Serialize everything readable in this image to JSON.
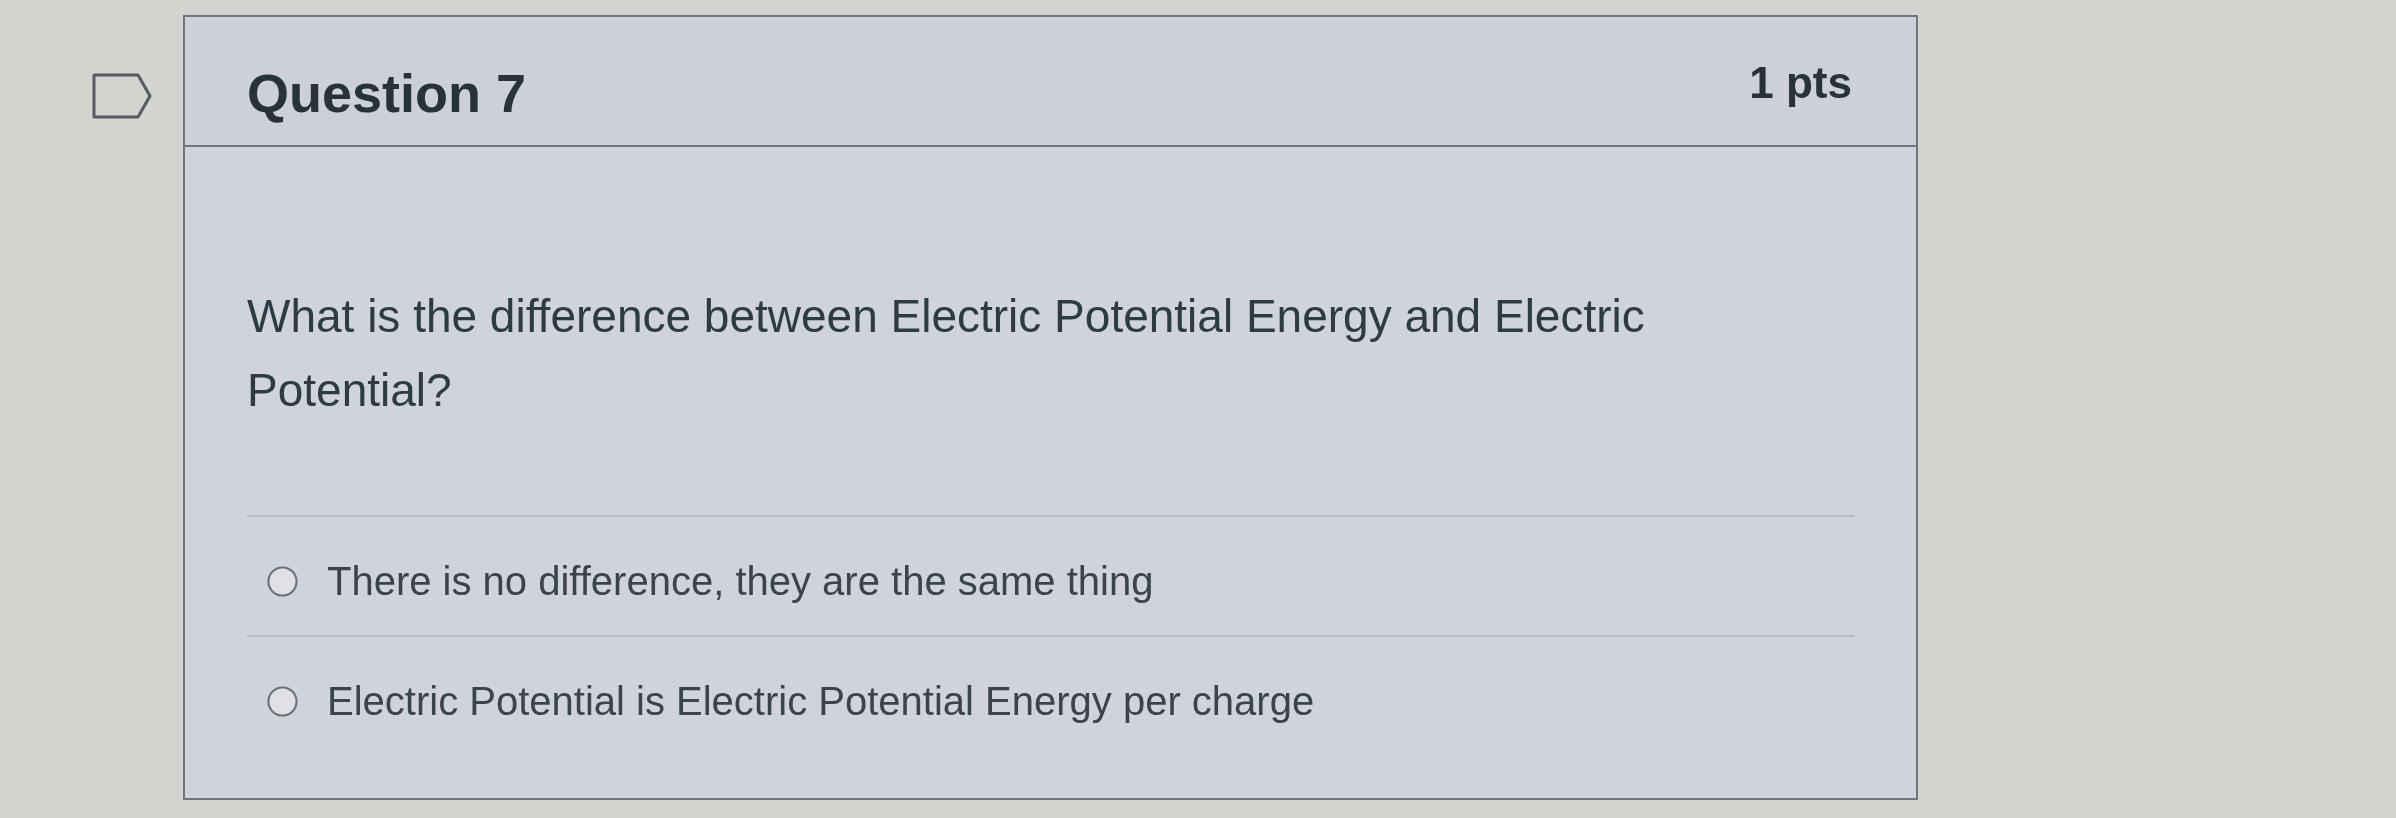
{
  "question": {
    "title": "Question 7",
    "points": "1 pts",
    "text": "What is the difference between Electric Potential Energy and Electric Potential?",
    "answers": [
      {
        "label": "There is no difference, they are the same thing",
        "selected": false
      },
      {
        "label": "Electric Potential is Electric Potential Energy per charge",
        "selected": false
      }
    ]
  }
}
